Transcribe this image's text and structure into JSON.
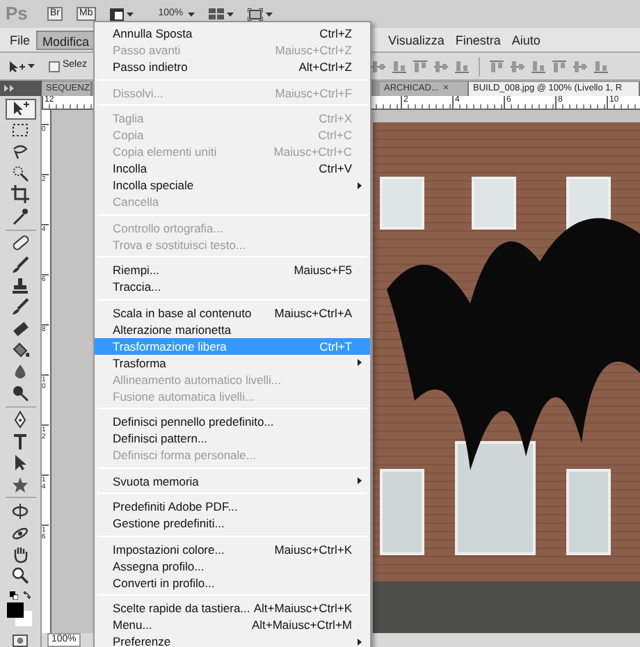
{
  "app_bar": {
    "logo": "Ps",
    "bridge": "Br",
    "mini_bridge": "Mb",
    "zoom": "100%"
  },
  "menu_bar": [
    {
      "label": "File",
      "selected": false
    },
    {
      "label": "Modifica",
      "selected": true
    },
    {
      "label": "Visualizza",
      "selected": false
    },
    {
      "label": "Finestra",
      "selected": false
    },
    {
      "label": "Aiuto",
      "selected": false
    }
  ],
  "options_bar": {
    "auto_select": {
      "label": "Selez",
      "checked": false
    }
  },
  "tabs": [
    {
      "label": "SEQUENZ",
      "selected": false
    },
    {
      "label": "ARCHICAD...",
      "close": "×",
      "selected": false
    },
    {
      "label": "BUILD_008.jpg @ 100% (Livello 1, R",
      "selected": true
    }
  ],
  "rulers": {
    "horizontal": [
      "12",
      "2",
      "4",
      "6",
      "8",
      "10"
    ],
    "vertical": [
      "0",
      "2",
      "4",
      "6",
      "8",
      "10",
      "12",
      "14",
      "16"
    ]
  },
  "tools": [
    {
      "kind": "move",
      "selected": true
    },
    {
      "kind": "marquee",
      "selected": false
    },
    {
      "kind": "lasso",
      "selected": false
    },
    {
      "kind": "wand",
      "selected": false
    },
    {
      "kind": "crop",
      "selected": false
    },
    {
      "kind": "eyedropper",
      "selected": false
    },
    {
      "kind": "bandage",
      "selected": false
    },
    {
      "kind": "brush",
      "selected": false
    },
    {
      "kind": "stamp",
      "selected": false
    },
    {
      "kind": "brush",
      "selected": false
    },
    {
      "kind": "eraser",
      "selected": false
    },
    {
      "kind": "bucket",
      "selected": false
    },
    {
      "kind": "drop",
      "selected": false
    },
    {
      "kind": "dodge",
      "selected": false
    },
    {
      "kind": "pen",
      "selected": false
    },
    {
      "kind": "type",
      "selected": false
    },
    {
      "kind": "arrow",
      "selected": false
    },
    {
      "kind": "shape",
      "selected": false
    },
    {
      "kind": "rotate",
      "selected": false
    },
    {
      "kind": "orbit",
      "selected": false
    },
    {
      "kind": "hand",
      "selected": false
    },
    {
      "kind": "zoom",
      "selected": false
    }
  ],
  "status_bar": {
    "zoom": "100%"
  },
  "edit_menu": {
    "groups": [
      [
        {
          "label": "Annulla Sposta",
          "shortcut": "Ctrl+Z",
          "disabled": false,
          "submenu": false,
          "selected": false
        },
        {
          "label": "Passo avanti",
          "shortcut": "Maiusc+Ctrl+Z",
          "disabled": true,
          "submenu": false,
          "selected": false
        },
        {
          "label": "Passo indietro",
          "shortcut": "Alt+Ctrl+Z",
          "disabled": false,
          "submenu": false,
          "selected": false
        }
      ],
      [
        {
          "label": "Dissolvi...",
          "shortcut": "Maiusc+Ctrl+F",
          "disabled": true,
          "submenu": false,
          "selected": false
        }
      ],
      [
        {
          "label": "Taglia",
          "shortcut": "Ctrl+X",
          "disabled": true,
          "submenu": false,
          "selected": false
        },
        {
          "label": "Copia",
          "shortcut": "Ctrl+C",
          "disabled": true,
          "submenu": false,
          "selected": false
        },
        {
          "label": "Copia elementi uniti",
          "shortcut": "Maiusc+Ctrl+C",
          "disabled": true,
          "submenu": false,
          "selected": false
        },
        {
          "label": "Incolla",
          "shortcut": "Ctrl+V",
          "disabled": false,
          "submenu": false,
          "selected": false
        },
        {
          "label": "Incolla speciale",
          "disabled": false,
          "submenu": true,
          "selected": false
        },
        {
          "label": "Cancella",
          "disabled": true,
          "submenu": false,
          "selected": false
        }
      ],
      [
        {
          "label": "Controllo ortografia...",
          "disabled": true,
          "submenu": false,
          "selected": false
        },
        {
          "label": "Trova e sostituisci testo...",
          "disabled": true,
          "submenu": false,
          "selected": false
        }
      ],
      [
        {
          "label": "Riempi...",
          "shortcut": "Maiusc+F5",
          "disabled": false,
          "submenu": false,
          "selected": false
        },
        {
          "label": "Traccia...",
          "disabled": false,
          "submenu": false,
          "selected": false
        }
      ],
      [
        {
          "label": "Scala in base al contenuto",
          "shortcut": "Maiusc+Ctrl+A",
          "disabled": false,
          "submenu": false,
          "selected": false
        },
        {
          "label": "Alterazione marionetta",
          "disabled": false,
          "submenu": false,
          "selected": false
        },
        {
          "label": "Trasformazione libera",
          "shortcut": "Ctrl+T",
          "disabled": false,
          "submenu": false,
          "selected": true
        },
        {
          "label": "Trasforma",
          "disabled": false,
          "submenu": true,
          "selected": false
        },
        {
          "label": "Allineamento automatico livelli...",
          "disabled": true,
          "submenu": false,
          "selected": false
        },
        {
          "label": "Fusione automatica livelli...",
          "disabled": true,
          "submenu": false,
          "selected": false
        }
      ],
      [
        {
          "label": "Definisci pennello predefinito...",
          "disabled": false,
          "submenu": false,
          "selected": false
        },
        {
          "label": "Definisci pattern...",
          "disabled": false,
          "submenu": false,
          "selected": false
        },
        {
          "label": "Definisci forma personale...",
          "disabled": true,
          "submenu": false,
          "selected": false
        }
      ],
      [
        {
          "label": "Svuota memoria",
          "disabled": false,
          "submenu": true,
          "selected": false
        }
      ],
      [
        {
          "label": "Predefiniti Adobe PDF...",
          "disabled": false,
          "submenu": false,
          "selected": false
        },
        {
          "label": "Gestione predefiniti...",
          "disabled": false,
          "submenu": false,
          "selected": false
        }
      ],
      [
        {
          "label": "Impostazioni colore...",
          "shortcut": "Maiusc+Ctrl+K",
          "disabled": false,
          "submenu": false,
          "selected": false
        },
        {
          "label": "Assegna profilo...",
          "disabled": false,
          "submenu": false,
          "selected": false
        },
        {
          "label": "Converti in profilo...",
          "disabled": false,
          "submenu": false,
          "selected": false
        }
      ],
      [
        {
          "label": "Scelte rapide da tastiera...",
          "shortcut": "Alt+Maiusc+Ctrl+K",
          "disabled": false,
          "submenu": false,
          "selected": false
        },
        {
          "label": "Menu...",
          "shortcut": "Alt+Maiusc+Ctrl+M",
          "disabled": false,
          "submenu": false,
          "selected": false
        },
        {
          "label": "Preferenze",
          "disabled": false,
          "submenu": true,
          "selected": false
        }
      ]
    ]
  }
}
